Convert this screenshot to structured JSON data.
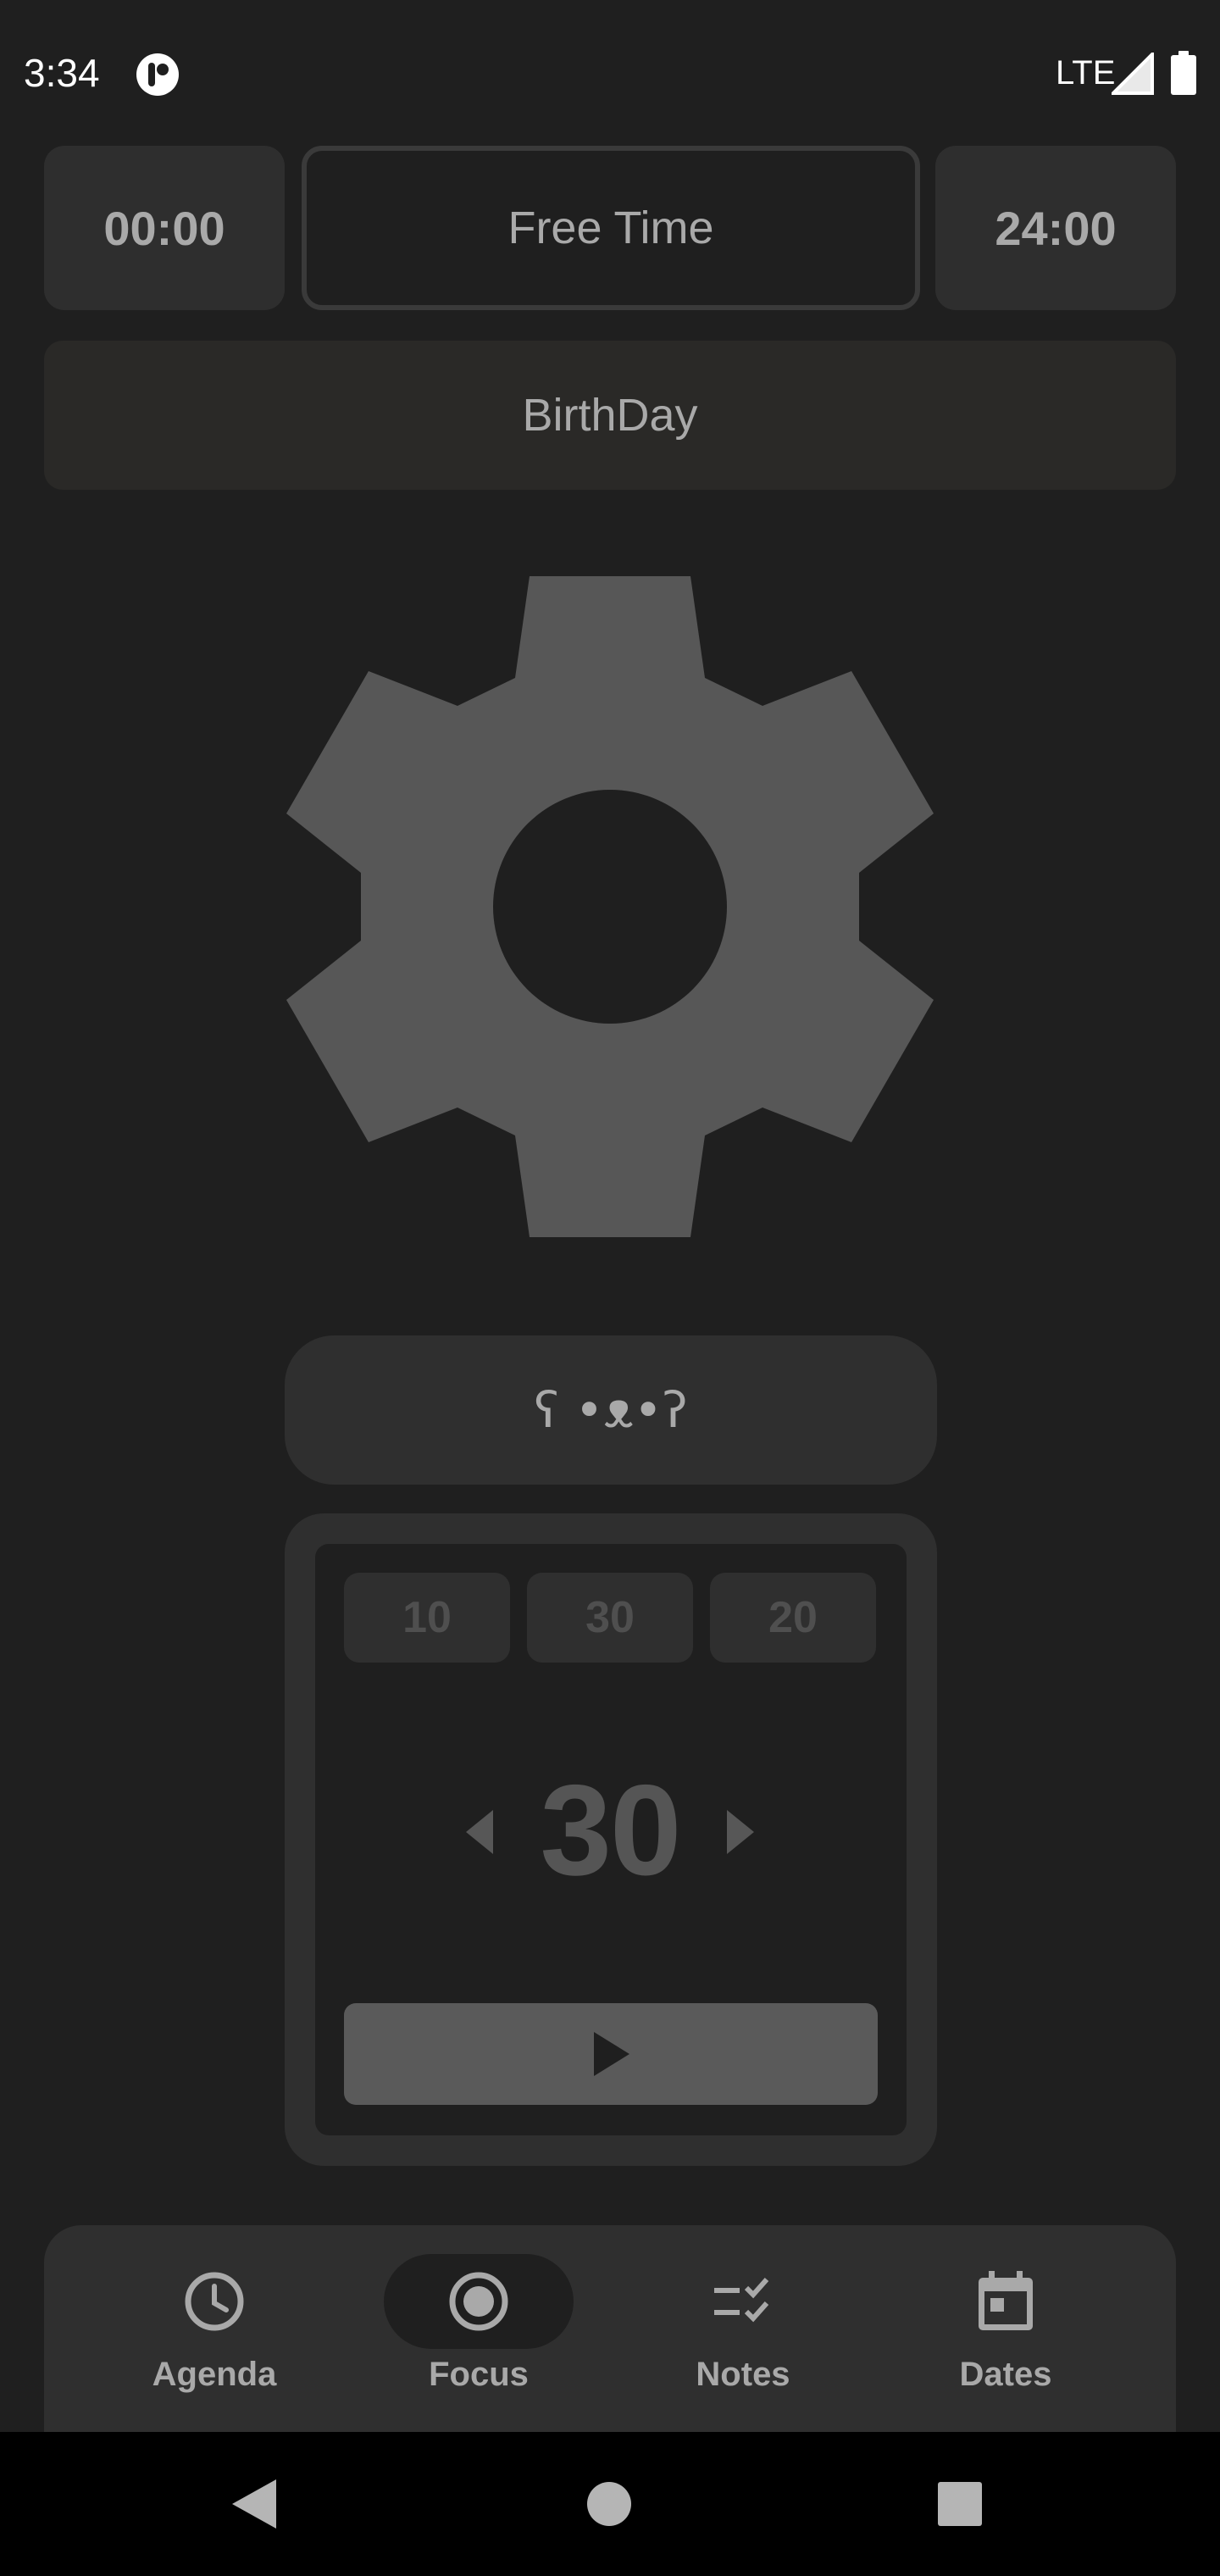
{
  "status_bar": {
    "time": "3:34",
    "network": "LTE",
    "icons": [
      "app-notification-icon",
      "signal-icon",
      "battery-icon"
    ]
  },
  "top_row": {
    "start_time": "00:00",
    "title": "Free Time",
    "end_time": "24:00"
  },
  "event_banner": {
    "label": "BirthDay"
  },
  "center_icon": "gear-icon",
  "mood_button": {
    "label": "ʕ •ᴥ•ʔ"
  },
  "timer": {
    "presets": [
      "10",
      "30",
      "20"
    ],
    "value": "30",
    "play_icon": "play-icon"
  },
  "bottom_nav": {
    "items": [
      {
        "label": "Agenda",
        "icon": "clock-icon",
        "active": false
      },
      {
        "label": "Focus",
        "icon": "focus-target-icon",
        "active": true
      },
      {
        "label": "Notes",
        "icon": "checklist-icon",
        "active": false
      },
      {
        "label": "Dates",
        "icon": "calendar-icon",
        "active": false
      }
    ]
  },
  "colors": {
    "background": "#1f1f1f",
    "surface": "#2f2f2f",
    "text": "#a9a9a9",
    "gear": "#575757"
  },
  "system_nav": [
    "back-icon",
    "home-icon",
    "recents-icon"
  ]
}
